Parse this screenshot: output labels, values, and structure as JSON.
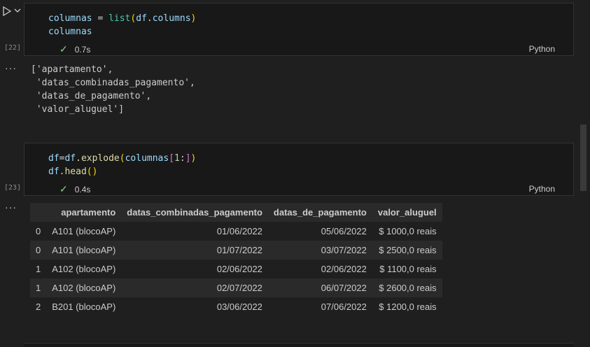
{
  "cell1": {
    "exec_count": "[22]",
    "code_line1": {
      "a": "columnas",
      "b": " = ",
      "c": "list",
      "d": "(",
      "e": "df",
      "f": ".columns",
      "g": ")"
    },
    "code_line2": "columnas",
    "status_check": "✓",
    "time": "0.7s",
    "language": "Python"
  },
  "output1": {
    "dots": "···",
    "lines": [
      "['apartamento',",
      " 'datas_combinadas_pagamento',",
      " 'datas_de_pagamento',",
      " 'valor_aluguel']"
    ]
  },
  "cell2": {
    "exec_count": "[23]",
    "code_line1": {
      "a": "df",
      "b": "=",
      "c": "df",
      "d": ".explode",
      "e": "(",
      "f": "columnas",
      "g": "[",
      "h": "1",
      "i": ":",
      "j": "]",
      "k": ")"
    },
    "code_line2": {
      "a": "df",
      "b": ".head",
      "c": "()"
    },
    "status_check": "✓",
    "time": "0.4s",
    "language": "Python"
  },
  "output2": {
    "dots": "···",
    "table": {
      "columns": [
        "",
        "apartamento",
        "datas_combinadas_pagamento",
        "datas_de_pagamento",
        "valor_aluguel"
      ],
      "rows": [
        [
          "0",
          "A101 (blocoAP)",
          "01/06/2022",
          "05/06/2022",
          "$ 1000,0 reais"
        ],
        [
          "0",
          "A101 (blocoAP)",
          "01/07/2022",
          "03/07/2022",
          "$ 2500,0 reais"
        ],
        [
          "1",
          "A102 (blocoAP)",
          "02/06/2022",
          "02/06/2022",
          "$ 1100,0 reais"
        ],
        [
          "1",
          "A102 (blocoAP)",
          "02/07/2022",
          "06/07/2022",
          "$ 2600,0 reais"
        ],
        [
          "2",
          "B201 (blocoAP)",
          "03/06/2022",
          "07/06/2022",
          "$ 1200,0 reais"
        ]
      ]
    }
  }
}
